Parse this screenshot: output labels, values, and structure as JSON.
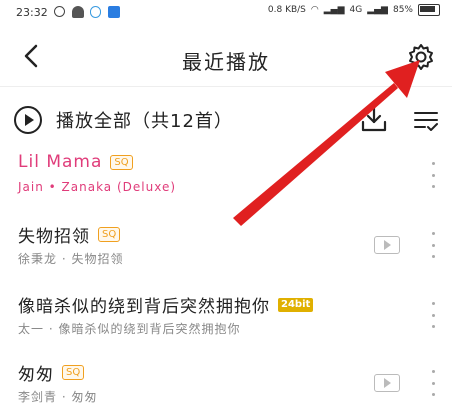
{
  "status_bar": {
    "time": "23:32",
    "speed": "0.8 KB/S",
    "network": "4G",
    "battery": "85%"
  },
  "header": {
    "title": "最近播放"
  },
  "toolbar": {
    "play_all_label": "播放全部（共12首）"
  },
  "songs": [
    {
      "title": "Lil Mama",
      "badge": "SQ",
      "subtitle": "Jain • Zanaka (Deluxe)",
      "highlighted": true,
      "has_mv": false
    },
    {
      "title": "失物招领",
      "badge": "SQ",
      "subtitle": "徐秉龙 · 失物招领",
      "highlighted": false,
      "has_mv": true
    },
    {
      "title": "像暗杀似的绕到背后突然拥抱你",
      "badge": "24bit",
      "subtitle": "太一 · 像暗杀似的绕到背后突然拥抱你",
      "highlighted": false,
      "has_mv": false
    },
    {
      "title": "匆匆",
      "badge": "SQ",
      "subtitle": "李剑青 · 匆匆",
      "highlighted": false,
      "has_mv": true
    }
  ],
  "colors": {
    "highlight": "#e03c7a",
    "annotation_arrow": "#e02020",
    "sq_badge": "#f0a020",
    "hires_badge": "#e0b000"
  },
  "icons": [
    "back-arrow-icon",
    "settings-gear-icon",
    "play-circle-icon",
    "download-icon",
    "multi-select-icon",
    "mv-icon",
    "more-vertical-icon"
  ]
}
